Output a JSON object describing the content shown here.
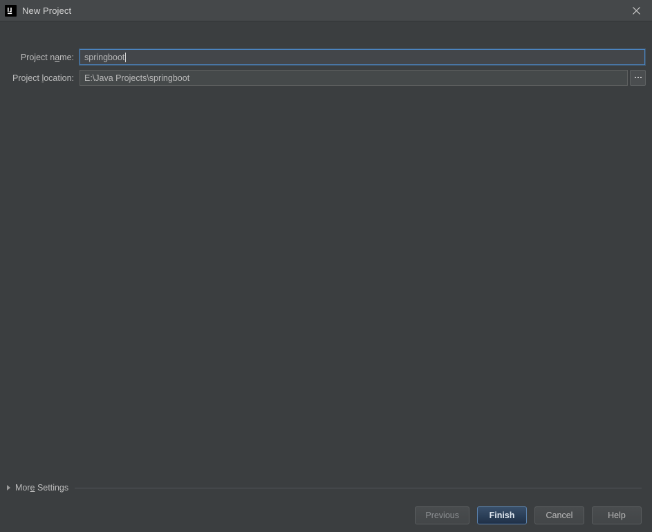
{
  "window": {
    "title": "New Project",
    "app_icon": "intellij-idea-logo-icon",
    "close_icon": "close-icon"
  },
  "form": {
    "project_name": {
      "label_before": "Project n",
      "label_mnemonic": "a",
      "label_after": "me:",
      "value": "springboot",
      "placeholder": "Project name"
    },
    "project_location": {
      "label_before": "Project ",
      "label_mnemonic": "l",
      "label_after": "ocation:",
      "value": "E:\\Java Projects\\springboot",
      "placeholder": "Project location",
      "browse_button_label": "...",
      "browse_icon": "ellipsis-icon"
    }
  },
  "more_settings": {
    "label_before": "Mor",
    "label_mnemonic": "e",
    "label_after": " Settings",
    "expanded": false,
    "disclosure_icon": "triangle-right-icon"
  },
  "buttons": [
    {
      "label": "Previous",
      "name": "previous-button",
      "state": "disabled"
    },
    {
      "label": "Finish",
      "name": "finish-button",
      "state": "default"
    },
    {
      "label": "Cancel",
      "name": "cancel-button",
      "state": "normal"
    },
    {
      "label": "Help",
      "name": "help-button",
      "state": "normal"
    }
  ],
  "colors": {
    "dialog_background": "#3b3e40",
    "titlebar_background": "#45484a",
    "field_background": "#45494a",
    "focus_border": "#4b86c4",
    "default_button": "#2b4668",
    "text": "#bcbcbc"
  }
}
